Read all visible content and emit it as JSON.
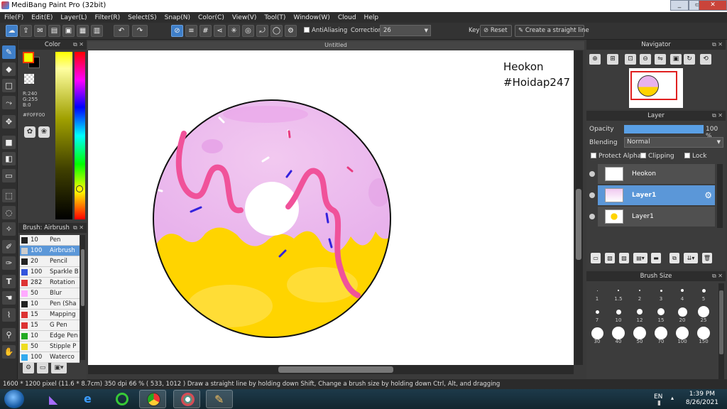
{
  "window": {
    "title": "MediBang Paint Pro (32bit)",
    "min": "_",
    "max": "▭",
    "close": "✕"
  },
  "menu": [
    "File(F)",
    "Edit(E)",
    "Layer(L)",
    "Filter(R)",
    "Select(S)",
    "Snap(N)",
    "Color(C)",
    "View(V)",
    "Tool(T)",
    "Window(W)",
    "Cloud",
    "Help"
  ],
  "toolbar": {
    "antialiasing_label": "AntiAliasing",
    "correction_label": "Correction",
    "correction_value": "26",
    "key_label": "Key",
    "reset_label": "Reset",
    "straight_line_label": "Create a straight line"
  },
  "color": {
    "panel_title": "Color",
    "r": "R:240",
    "g": "G:255",
    "b": "B:0",
    "hex": "#F0FF00",
    "primary": "#F0FF00",
    "secondary": "#000000"
  },
  "brush_panel": {
    "title": "Brush: Airbrush",
    "items": [
      {
        "size": "10",
        "name": "Pen",
        "color": "#222222"
      },
      {
        "size": "100",
        "name": "Airbrush",
        "color": "#cccccc"
      },
      {
        "size": "20",
        "name": "Pencil",
        "color": "#222222"
      },
      {
        "size": "100",
        "name": "Sparkle B",
        "color": "#3355dd"
      },
      {
        "size": "282",
        "name": "Rotation",
        "color": "#dd3333"
      },
      {
        "size": "50",
        "name": "Blur",
        "color": "#ffaaff"
      },
      {
        "size": "10",
        "name": "Pen (Sha",
        "color": "#222222"
      },
      {
        "size": "15",
        "name": "Mapping",
        "color": "#dd3333"
      },
      {
        "size": "15",
        "name": "G Pen",
        "color": "#dd3333"
      },
      {
        "size": "10",
        "name": "Edge Pen",
        "color": "#22aa22"
      },
      {
        "size": "50",
        "name": "Stipple P",
        "color": "#eedd22"
      },
      {
        "size": "100",
        "name": "Waterco",
        "color": "#33aaee"
      }
    ]
  },
  "document": {
    "tab_title": "Untitled",
    "canvas_text_line1": "Heokon",
    "canvas_text_line2": "#Hoidap247"
  },
  "navigator": {
    "title": "Navigator"
  },
  "layer_panel": {
    "title": "Layer",
    "opacity_label": "Opacity",
    "opacity_value": "100 %",
    "opacity_fraction": 1.0,
    "blending_label": "Blending",
    "blending_value": "Normal",
    "protect_alpha_label": "Protect Alpha",
    "clipping_label": "Clipping",
    "lock_label": "Lock",
    "layers": [
      {
        "name": "Heokon",
        "selected": false
      },
      {
        "name": "Layer1",
        "selected": true
      },
      {
        "name": "Layer1",
        "selected": false
      }
    ]
  },
  "brush_size": {
    "title": "Brush Size",
    "sizes": [
      "1",
      "1.5",
      "2",
      "3",
      "4",
      "5",
      "7",
      "10",
      "12",
      "15",
      "20",
      "25",
      "30",
      "40",
      "50",
      "70",
      "100",
      "150"
    ]
  },
  "statusbar": {
    "text": "1600 * 1200 pixel  (11.6 * 8.7cm)  350 dpi  66 %  ( 533, 1012 )  Draw a straight line by holding down Shift, Change a brush size by holding down Ctrl, Alt, and dragging"
  },
  "taskbar": {
    "lang": "EN",
    "time": "1:39 PM",
    "date": "8/26/2021"
  }
}
